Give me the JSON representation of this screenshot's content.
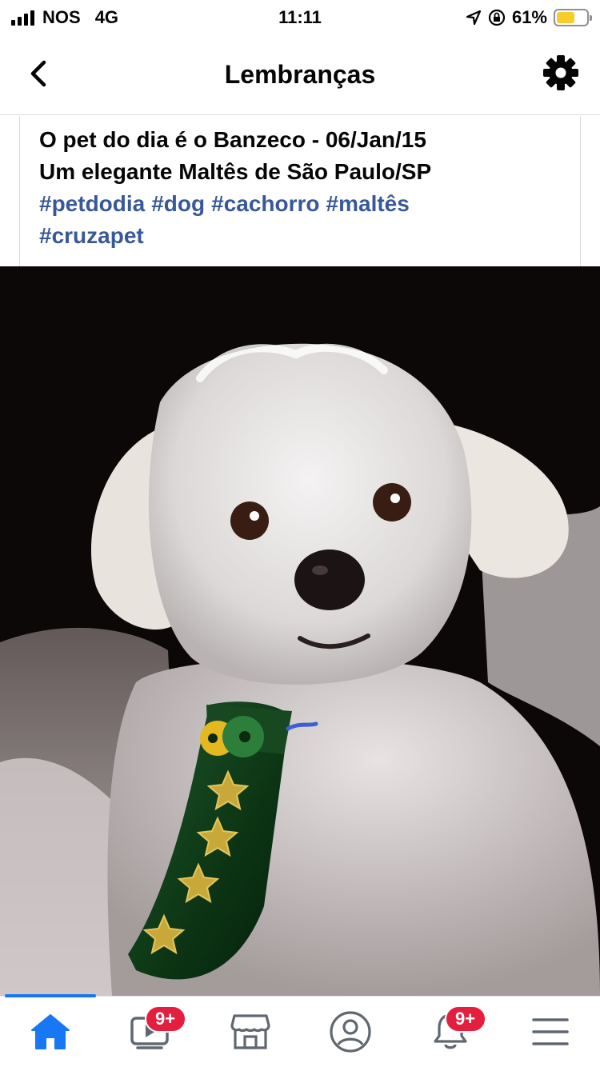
{
  "status_bar": {
    "carrier": "NOS",
    "network": "4G",
    "time": "11:11",
    "battery_percent_label": "61%",
    "battery_level": 0.61
  },
  "header": {
    "title": "Lembranças",
    "back_icon": "chevron-left-icon",
    "settings_icon": "gear-icon"
  },
  "post": {
    "line1": "O pet do dia é o Banzeco - 06/Jan/15",
    "line2": "Um elegante Maltês de São Paulo/SP",
    "hashtags": [
      "#petdodia",
      "#dog",
      "#cachorro",
      "#maltês",
      "#cruzapet"
    ],
    "hashtag_color": "#385898"
  },
  "bottom_nav": {
    "active_color": "#1877f2",
    "items": [
      {
        "icon": "home-icon",
        "active": true
      },
      {
        "icon": "video-icon",
        "badge": "9+"
      },
      {
        "icon": "marketplace-icon"
      },
      {
        "icon": "profile-icon"
      },
      {
        "icon": "bell-icon",
        "badge": "9+"
      },
      {
        "icon": "menu-icon"
      }
    ]
  }
}
